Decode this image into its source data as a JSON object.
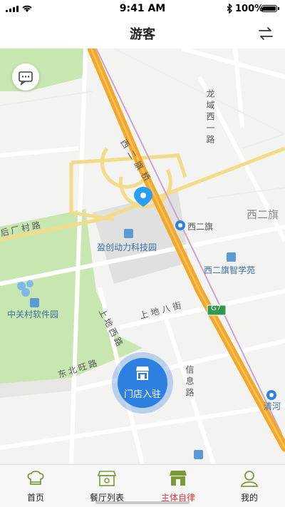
{
  "status": {
    "time": "9:41 AM",
    "battery": "100%"
  },
  "nav": {
    "title": "游客"
  },
  "map": {
    "labels": {
      "longyu_road": "龙域西一路",
      "xierqi_bridge": "西二旗桥",
      "xierqi_area": "西二旗",
      "xierqi_station": "西二旗",
      "houchangcun_road": "后厂村路",
      "yingchuang_park": "盈创动力科技园",
      "xierqi_zhixue": "西二旗智学苑",
      "zhongguancun_park": "中关村软件园",
      "shangdi_west_road": "上地西路",
      "shangdi_8th_street": "上地八街",
      "dongbeiwang_road": "东北旺路",
      "xinxi_road": "信息路",
      "qinghe": "清河",
      "g7": "G7"
    }
  },
  "store_button": {
    "label": "门店入驻"
  },
  "tabs": [
    {
      "label": "首页",
      "icon": "chef-hat-icon"
    },
    {
      "label": "餐厅列表",
      "icon": "restaurant-icon"
    },
    {
      "label": "主体自律",
      "icon": "store-icon"
    },
    {
      "label": "我的",
      "icon": "user-icon"
    }
  ],
  "colors": {
    "active_tab": "#e0393e",
    "accent_blue": "#2d7fe0",
    "tab_green": "#7a9a3a"
  }
}
